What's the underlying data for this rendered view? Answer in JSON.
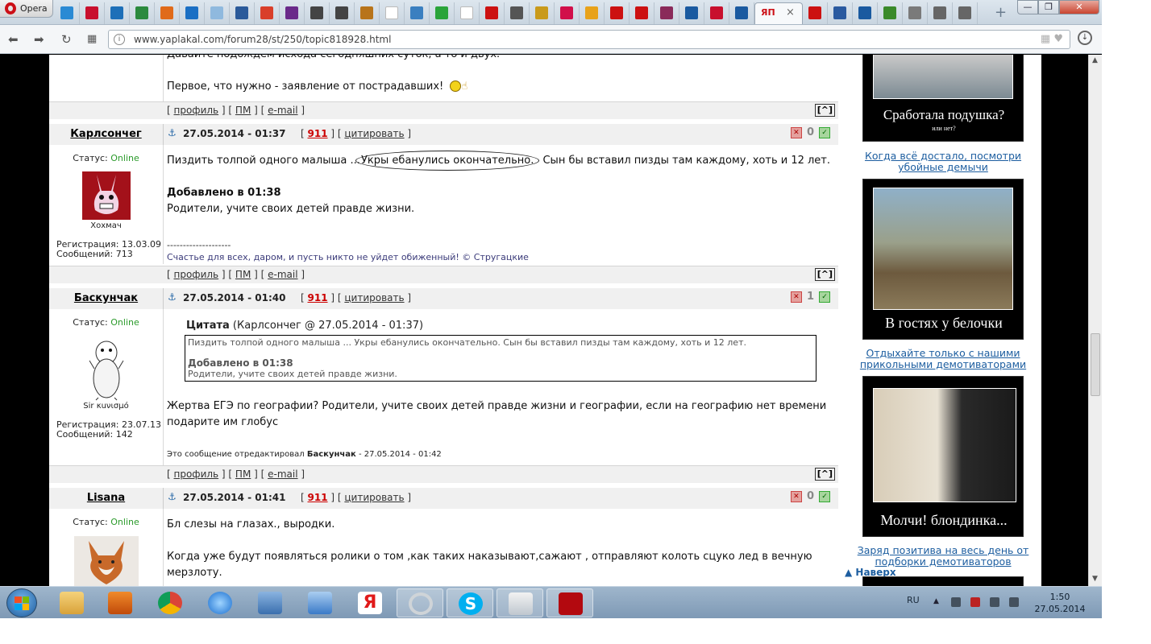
{
  "browser": {
    "menu_label": "Opera",
    "active_tab_label": "ЯП",
    "url": "www.yaplakal.com/forum28/st/250/topic818928.html",
    "tab_favicons": [
      "#2a8ad4",
      "#c8102e",
      "#1d6fb8",
      "#2b8a3e",
      "#e06a1a",
      "#1a6fc4",
      "#8fb9de",
      "#2a5a9a",
      "#d93f2a",
      "#6a2a8a",
      "#444444",
      "#444444",
      "#b8741a",
      "#ffffff",
      "#3a7fc0",
      "#2aa43a",
      "#ffffff",
      "#cc1111",
      "#555555",
      "#c99a1a",
      "#d10f4a",
      "#e8a21a",
      "#cc1111",
      "#cc1111",
      "#8a2a5a",
      "#1a5aa0",
      "#c8102e",
      "#1a5aa0",
      "#cc1111",
      "#2a5aa0",
      "#1a5aa0",
      "#3a8a2a",
      "#7a7a7a",
      "#666666",
      "#666666"
    ]
  },
  "posts": {
    "prev": {
      "text_line1": "Давайте подождем исхода сегодняшних суток, а то и двух.",
      "text_line2": "Первое, что нужно - заявление от пострадавших!"
    },
    "links": {
      "profile": "профиль",
      "pm": "ПМ",
      "email": "e-mail",
      "to_top": "[^]"
    },
    "p1": {
      "author": "Карлсончег",
      "date": "27.05.2014 - 01:37",
      "num": "911",
      "quote_label": "цитировать",
      "rating": "0",
      "status_label": "Статус:",
      "status_value": "Online",
      "nick": "Хохмач",
      "reg": "Регистрация: 13.03.09",
      "msgs": "Сообщений: 713",
      "text1_a": "Пиздить толпой одного малыша ... ",
      "text1_b": "Укры ебанулись окончательно.",
      "text1_c": " Сын бы вставил пизды там каждому, хоть и 12 лет.",
      "added": "Добавлено в 01:38",
      "text2": "Родители, учите своих детей правде жизни.",
      "sig_sep": "--------------------",
      "sig": "Счастье для всех, даром, и пусть никто не уйдет обиженный! © Стругацкие"
    },
    "p2": {
      "author": "Баскунчак",
      "date": "27.05.2014 - 01:40",
      "num": "911",
      "quote_label": "цитировать",
      "rating": "1",
      "status_label": "Статус:",
      "status_value": "Online",
      "nick": "Sir κuνισμό",
      "reg": "Регистрация: 23.07.13",
      "msgs": "Сообщений: 142",
      "quote_head": "Цитата",
      "quote_src": " (Карлсончег @ 27.05.2014 - 01:37)",
      "quote_l1": "Пиздить толпой одного малыша ... Укры ебанулись окончательно. Сын бы вставил пизды там каждому, хоть и 12 лет.",
      "quote_added": "Добавлено в 01:38",
      "quote_l2": "Родители, учите своих детей правде жизни.",
      "text_l1": "Жертва ЕГЭ по географии? Родители, учите своих детей правде жизни и географии, если на географию нет времени",
      "text_l2": "подарите им глобус",
      "edited_a": "Это сообщение отредактировал ",
      "edited_user": "Баскунчак",
      "edited_b": " - 27.05.2014 - 01:42"
    },
    "p3": {
      "author": "Lisana",
      "date": "27.05.2014 - 01:41",
      "num": "911",
      "quote_label": "цитировать",
      "rating": "0",
      "status_label": "Статус:",
      "status_value": "Online",
      "text1": "Бл слезы на глазах., выродки.",
      "text2_l1": "Когда уже будут появляться ролики о том ,как таких наказывают,сажают , отправляют колоть сцуко лед в вечную",
      "text2_l2": "мерзлоту."
    }
  },
  "sidebar": {
    "demo1_caption": "Сработала подушка?",
    "demo1_sub": "или нет?",
    "demo1_link": "Когда всё достало, посмотри убойные демычи",
    "demo2_caption": "В гостях у белочки",
    "demo2_link": "Отдыхайте только с нашими прикольными демотиваторами",
    "demo3_caption": "Молчи! блондинка...",
    "demo3_link": "Заряд позитива на весь день от подборки демотиваторов",
    "to_top": "Наверх"
  },
  "taskbar": {
    "lang": "RU",
    "time": "1:50",
    "date": "27.05.2014"
  }
}
